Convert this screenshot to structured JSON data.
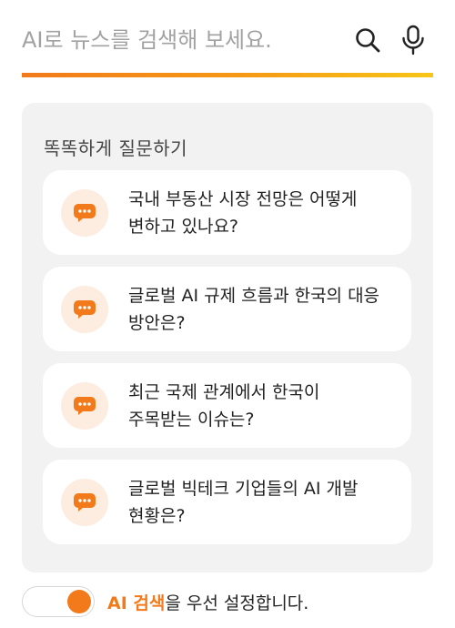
{
  "search": {
    "placeholder": "AI로 뉴스를 검색해 보세요.",
    "value": ""
  },
  "suggestions": {
    "title": "똑똑하게 질문하기",
    "items": [
      {
        "text": "국내 부동산 시장 전망은 어떻게\n변하고 있나요?",
        "icon": "chat-bubble-icon"
      },
      {
        "text": "글로벌 AI 규제 흐름과 한국의 대응\n방안은?",
        "icon": "chat-bubble-icon"
      },
      {
        "text": "최근 국제 관계에서 한국이\n주목받는 이슈는?",
        "icon": "chat-bubble-icon"
      },
      {
        "text": "글로벌 빅테크 기업들의 AI 개발\n현황은?",
        "icon": "chat-bubble-icon"
      }
    ]
  },
  "ai_toggle": {
    "enabled": true,
    "label_highlight": "AI 검색",
    "label_rest": "을 우선 설정합니다."
  },
  "colors": {
    "accent": "#f27a1a",
    "accent_yellow": "#f7c617",
    "panel_bg": "#f2f2f2",
    "icon_bg": "#fdece0"
  }
}
